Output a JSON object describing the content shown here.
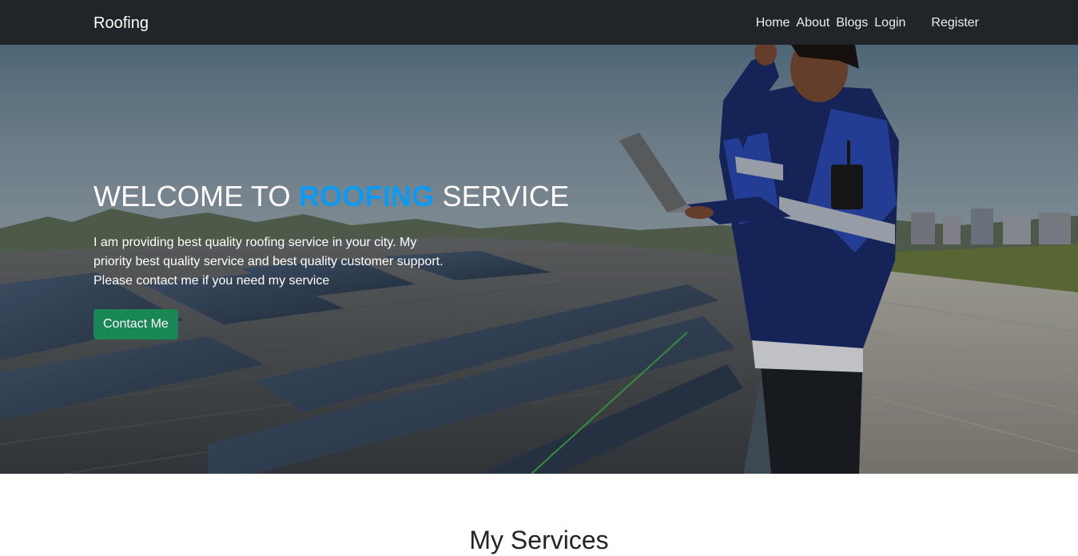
{
  "navbar": {
    "brand": "Roofing",
    "links": [
      {
        "label": "Home"
      },
      {
        "label": "About"
      },
      {
        "label": "Blogs"
      },
      {
        "label": "Login"
      },
      {
        "label": "Register"
      }
    ]
  },
  "hero": {
    "title_prefix": "WELCOME TO ",
    "title_accent": "ROOFING",
    "title_suffix": " SERVICE",
    "description": "I am providing best quality roofing service in your city. My priority best quality service and best quality customer support. Please contact me if you need my service",
    "cta_label": "Contact Me",
    "accent_color": "#0d9af2",
    "cta_color": "#198754",
    "image": "roof-solar-panels-worker-photo"
  },
  "services": {
    "title": "My Services"
  },
  "colors": {
    "navbar_bg": "#212529",
    "page_bg": "#ffffff"
  }
}
